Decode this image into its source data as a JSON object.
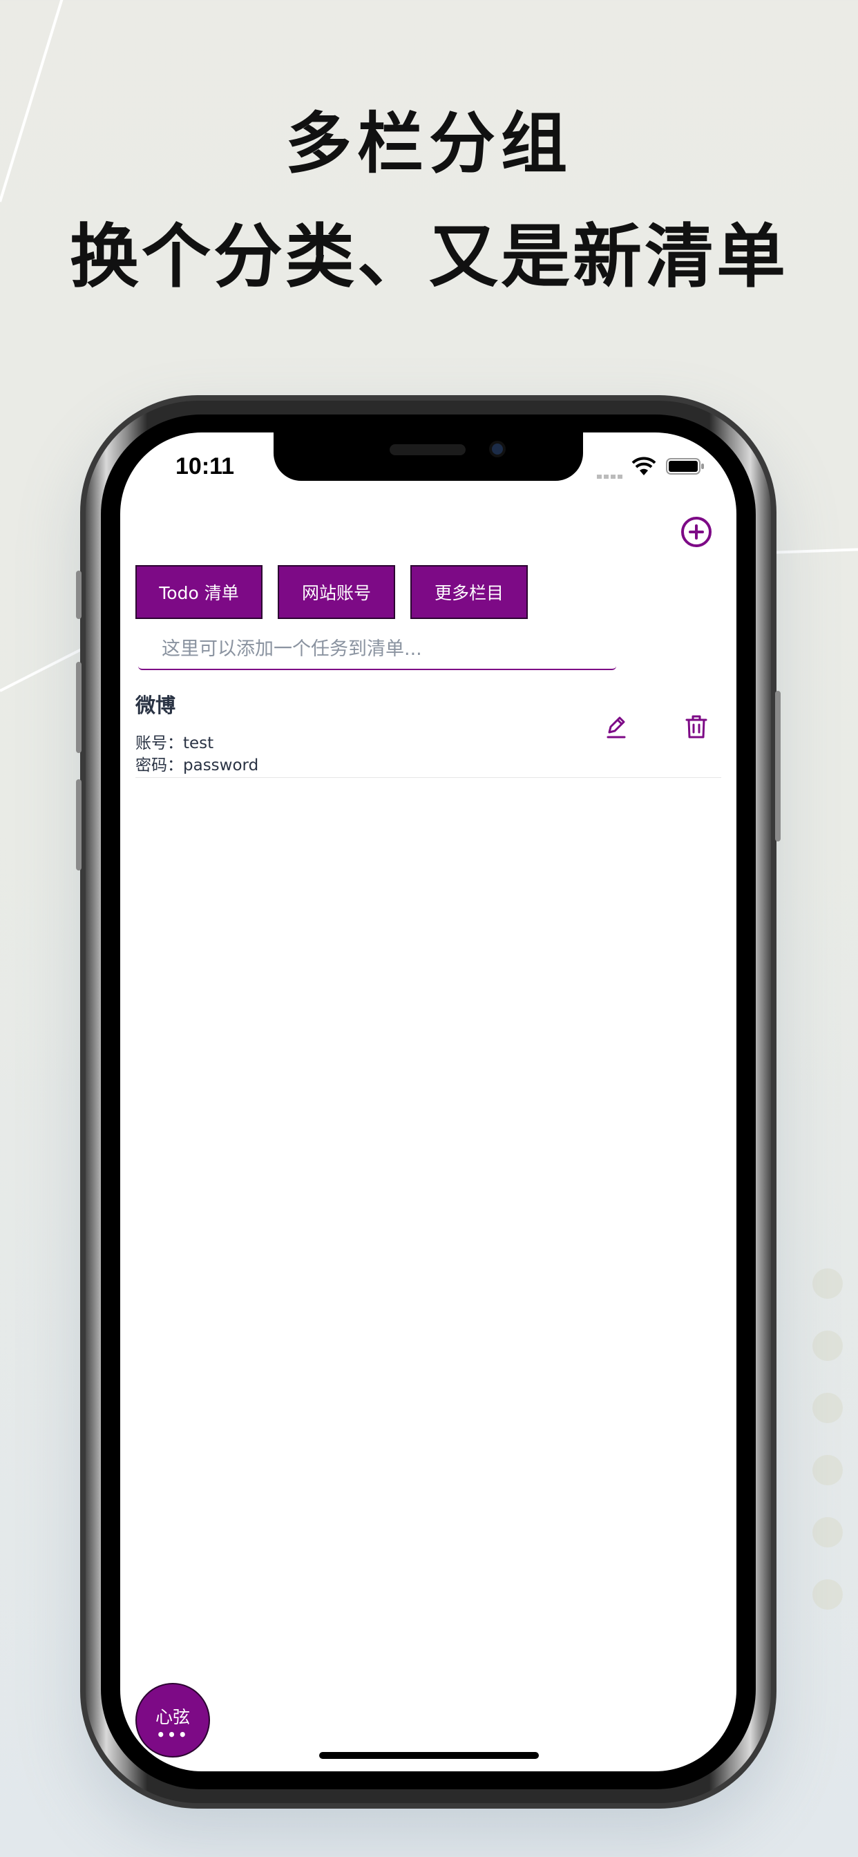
{
  "promo": {
    "headline_1": "多栏分组",
    "headline_2": "换个分类、又是新清单"
  },
  "status_bar": {
    "time": "10:11",
    "icons": [
      "signal-icon",
      "wifi-icon",
      "battery-icon"
    ]
  },
  "header": {
    "add_icon": "plus-circle-icon"
  },
  "tabs": [
    {
      "label": "Todo 清单"
    },
    {
      "label": "网站账号"
    },
    {
      "label": "更多栏目"
    }
  ],
  "task_input": {
    "value": "",
    "placeholder": "这里可以添加一个任务到清单..."
  },
  "items": [
    {
      "title": "微博",
      "account_line": "账号：test",
      "password_line": "密码：password",
      "actions": [
        "edit-icon",
        "trash-icon"
      ]
    }
  ],
  "fab": {
    "label": "心弦",
    "dots": "•••"
  },
  "colors": {
    "accent": "#7d0a86",
    "text": "#2a3344",
    "placeholder": "#8a93a0",
    "background": "#ebebe6"
  }
}
